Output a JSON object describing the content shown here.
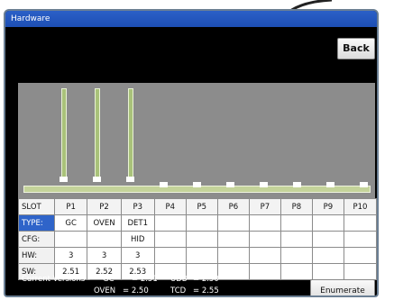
{
  "window": {
    "title": "Hardware"
  },
  "buttons": {
    "back": "Back",
    "enumerate": "Enumerate"
  },
  "slots": {
    "row_headers": [
      "SLOT",
      "TYPE:",
      "CFG:",
      "HW:",
      "SW:"
    ],
    "names": [
      "P1",
      "P2",
      "P3",
      "P4",
      "P5",
      "P6",
      "P7",
      "P8",
      "P9",
      "P10"
    ],
    "type": [
      "GC",
      "OVEN",
      "DET1",
      "",
      "",
      "",
      "",
      "",
      "",
      ""
    ],
    "cfg": [
      "",
      "",
      "HID",
      "",
      "",
      "",
      "",
      "",
      "",
      ""
    ],
    "hw": [
      "3",
      "3",
      "3",
      "",
      "",
      "",
      "",
      "",
      "",
      ""
    ],
    "sw": [
      "2.51",
      "2.52",
      "2.53",
      "",
      "",
      "",
      "",
      "",
      "",
      ""
    ]
  },
  "versions": {
    "label": "Current Versions -",
    "gc_label": "GC",
    "gc_value": "= 2.51",
    "udb_label": "UDB",
    "udb_value": "= 2.50",
    "oven_label": "OVEN",
    "oven_value": "= 2.50",
    "tcd_label": "TCD",
    "tcd_value": "= 2.55"
  },
  "colors": {
    "title_bar": "#1d4fb5",
    "bar_fill": "#a9c27a",
    "panel": "#8c8c8c",
    "selected_cell": "#2f64c9"
  }
}
